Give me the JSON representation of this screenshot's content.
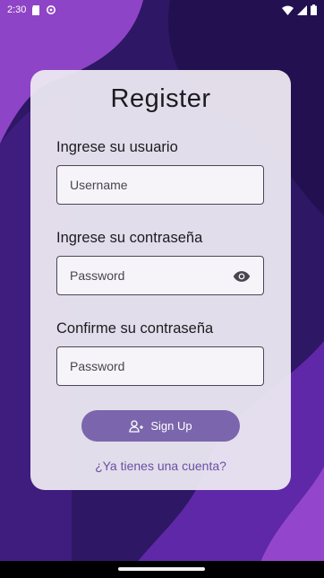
{
  "status": {
    "time": "2:30"
  },
  "form": {
    "title": "Register",
    "username_label": "Ingrese su usuario",
    "username_placeholder": "Username",
    "password_label": "Ingrese su contraseña",
    "password_placeholder": "Password",
    "confirm_label": "Confirme su contraseña",
    "confirm_placeholder": "Password",
    "signup_label": "Sign Up",
    "login_link": "¿Ya tienes una cuenta?"
  },
  "colors": {
    "accent": "#7b66ad",
    "link": "#6a50a6",
    "background_dark": "#2c1660",
    "background_light": "#8a43c4"
  },
  "icons": [
    "sd-card-icon",
    "sync-icon",
    "wifi-icon",
    "signal-icon",
    "battery-icon",
    "visibility-icon",
    "person-add-icon"
  ]
}
